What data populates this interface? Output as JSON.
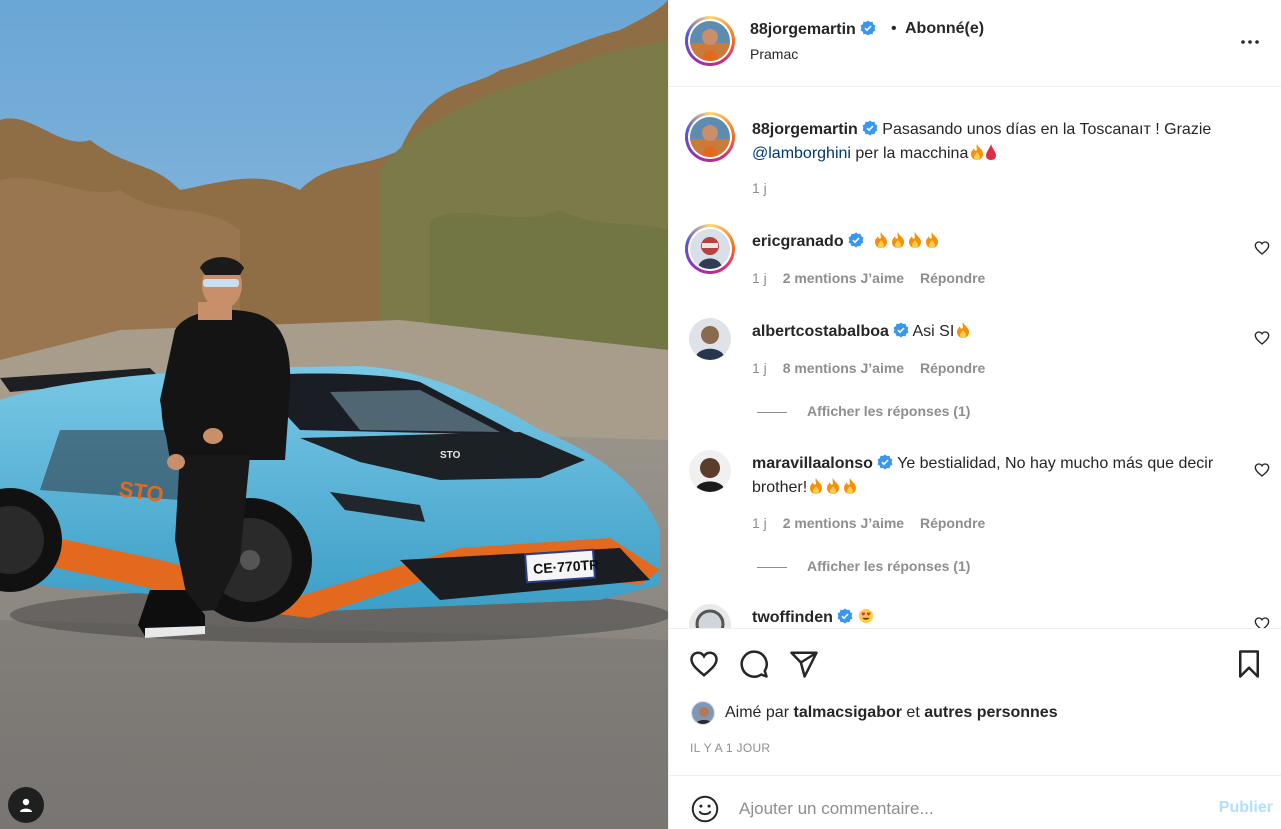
{
  "post": {
    "author": "88jorgemartin",
    "follow_status": "Abonné(e)",
    "location": "Pramac",
    "caption_text": "Pasasando unos días en la Toscanaıт ! Grazie",
    "caption_mention": "@lamborghini",
    "caption_tail": "per la macchina",
    "caption_time": "1 j"
  },
  "comments": [
    {
      "username": "ericgranado",
      "text": "",
      "time": "1 j",
      "likes": "2 mentions J’aime",
      "reply": "Répondre"
    },
    {
      "username": "albertcostabalboa",
      "text": "Asi SI",
      "time": "1 j",
      "likes": "8 mentions J’aime",
      "reply": "Répondre",
      "view_replies": "Afficher les réponses (1)"
    },
    {
      "username": "maravillaalonso",
      "text": "Ye bestialidad, No hay mucho más que decir brother!",
      "time": "1 j",
      "likes": "2 mentions J’aime",
      "reply": "Répondre",
      "view_replies": "Afficher les réponses (1)"
    },
    {
      "username": "twoffinden",
      "text": ""
    }
  ],
  "liked_by": {
    "prefix": "Aimé par",
    "user": "talmacsigabor",
    "connector": "et",
    "others": "autres personnes"
  },
  "timestamp": "IL Y A 1 JOUR",
  "add_comment": {
    "placeholder": "Ajouter un commentaire...",
    "post_label": "Publier"
  },
  "car": {
    "plate": "CE·770TR",
    "badge": "STO"
  },
  "colors": {
    "verified": "#3897f0",
    "car_blue": "#4fb4d8",
    "car_orange": "#e2691e",
    "post_button": "#b2dffc"
  }
}
